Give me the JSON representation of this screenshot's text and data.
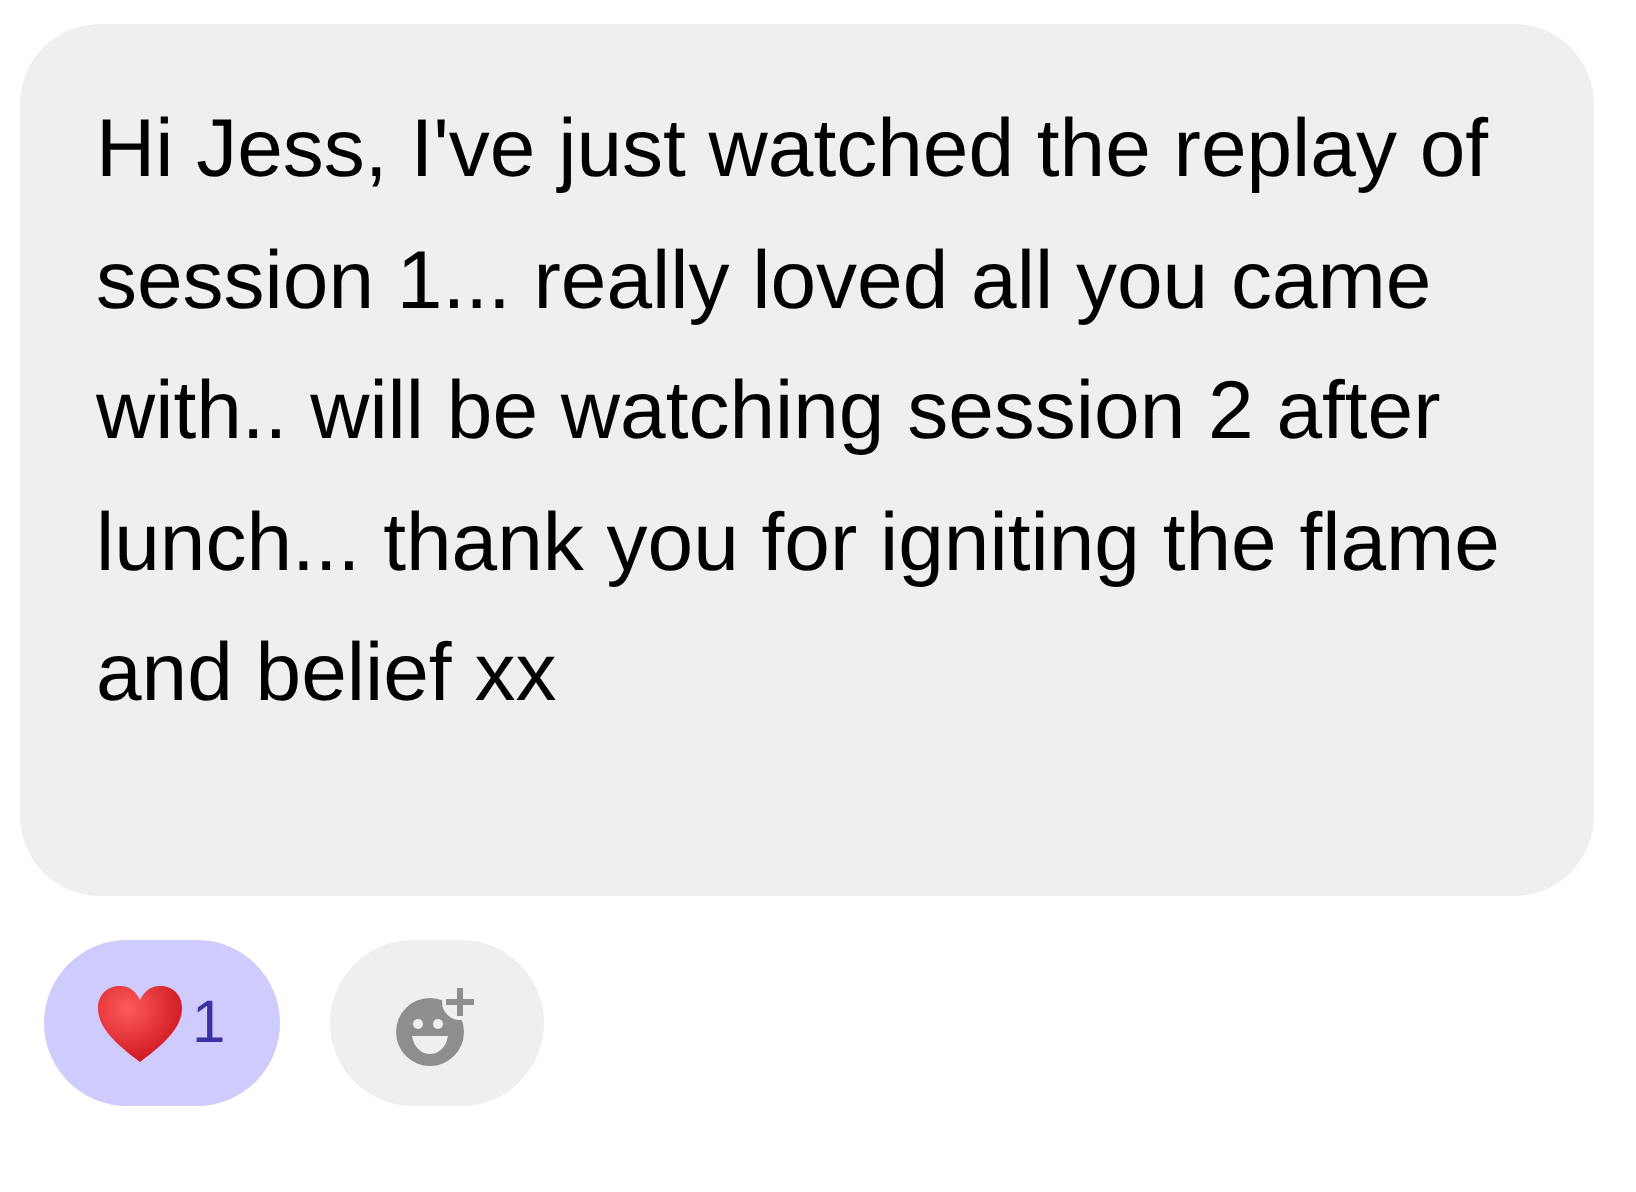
{
  "message": {
    "text": "Hi Jess, I've just watched the replay of session 1... really loved all you came with.. will be watching session 2 after lunch... thank you for igniting the flame and belief xx"
  },
  "reactions": [
    {
      "count": "1",
      "selected": true
    }
  ]
}
